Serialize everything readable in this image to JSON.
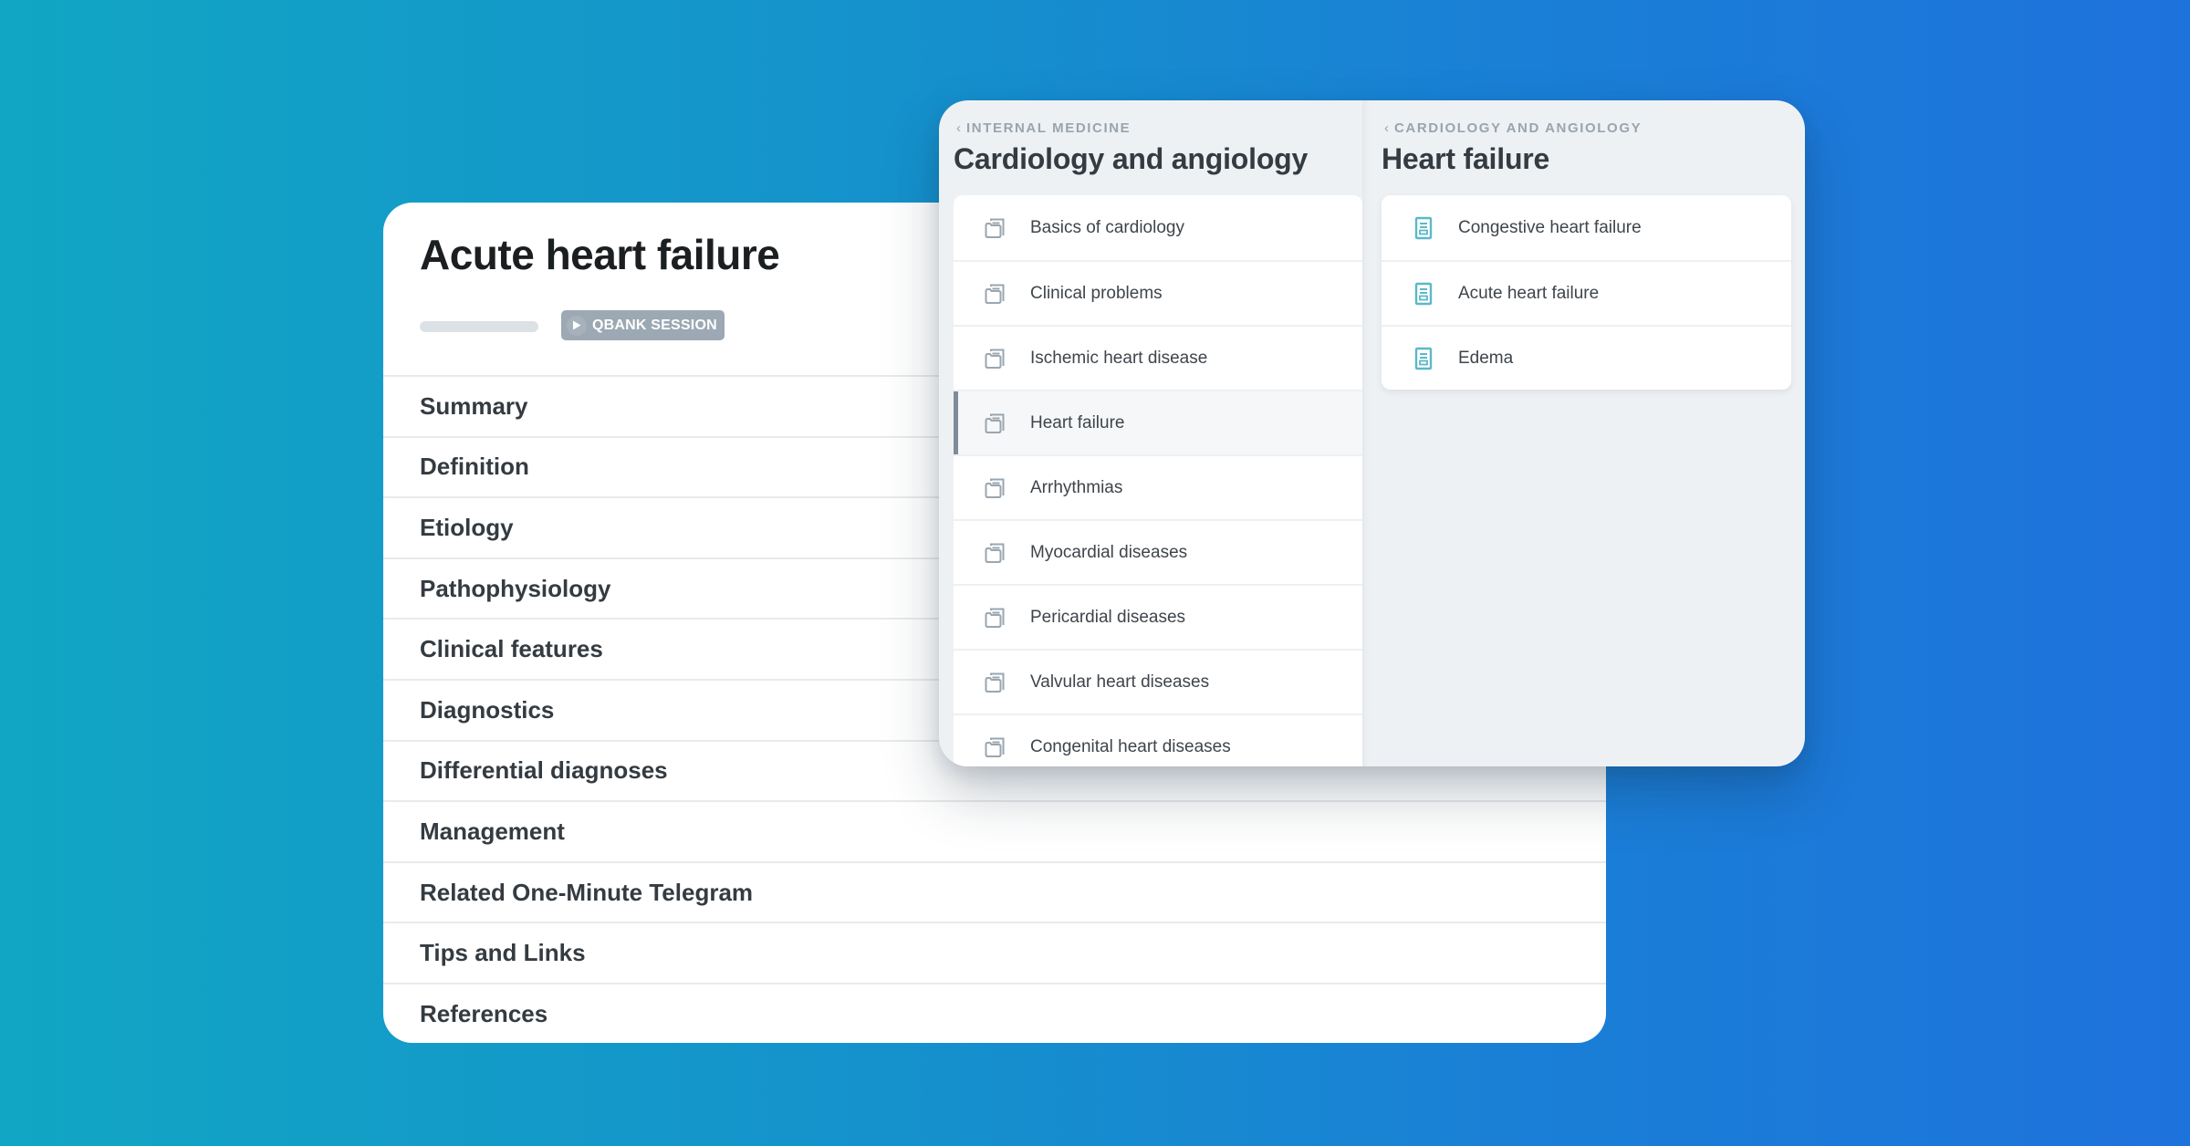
{
  "colors": {
    "background_start": "#11a6c4",
    "background_end": "#1e72dc",
    "article_icon": "#5bb8c9",
    "folder_icon": "#9aa6b0",
    "selected_indicator": "#7f8c98"
  },
  "article": {
    "title": "Acute heart failure",
    "progress": 0,
    "qbank_button": {
      "label": "QBANK SESSION",
      "icon": "play-icon"
    },
    "sections": [
      "Summary",
      "Definition",
      "Etiology",
      "Pathophysiology",
      "Clinical features",
      "Diagnostics",
      "Differential diagnoses",
      "Management",
      "Related One-Minute Telegram",
      "Tips and Links",
      "References"
    ]
  },
  "nav": {
    "left_column": {
      "breadcrumb": {
        "icon": "chevron-left-icon",
        "label": "INTERNAL MEDICINE"
      },
      "title": "Cardiology and angiology",
      "items": [
        {
          "label": "Basics of cardiology",
          "icon": "folder-icon",
          "selected": false
        },
        {
          "label": "Clinical problems",
          "icon": "folder-icon",
          "selected": false
        },
        {
          "label": "Ischemic heart disease",
          "icon": "folder-icon",
          "selected": false
        },
        {
          "label": "Heart failure",
          "icon": "folder-icon",
          "selected": true
        },
        {
          "label": "Arrhythmias",
          "icon": "folder-icon",
          "selected": false
        },
        {
          "label": "Myocardial diseases",
          "icon": "folder-icon",
          "selected": false
        },
        {
          "label": "Pericardial diseases",
          "icon": "folder-icon",
          "selected": false
        },
        {
          "label": "Valvular heart diseases",
          "icon": "folder-icon",
          "selected": false
        },
        {
          "label": "Congenital heart diseases",
          "icon": "folder-icon",
          "selected": false
        }
      ]
    },
    "right_column": {
      "breadcrumb": {
        "icon": "chevron-left-icon",
        "label": "CARDIOLOGY AND ANGIOLOGY"
      },
      "title": "Heart failure",
      "items": [
        {
          "label": "Congestive heart failure",
          "icon": "article-icon"
        },
        {
          "label": "Acute heart failure",
          "icon": "article-icon"
        },
        {
          "label": "Edema",
          "icon": "article-icon"
        }
      ]
    }
  }
}
